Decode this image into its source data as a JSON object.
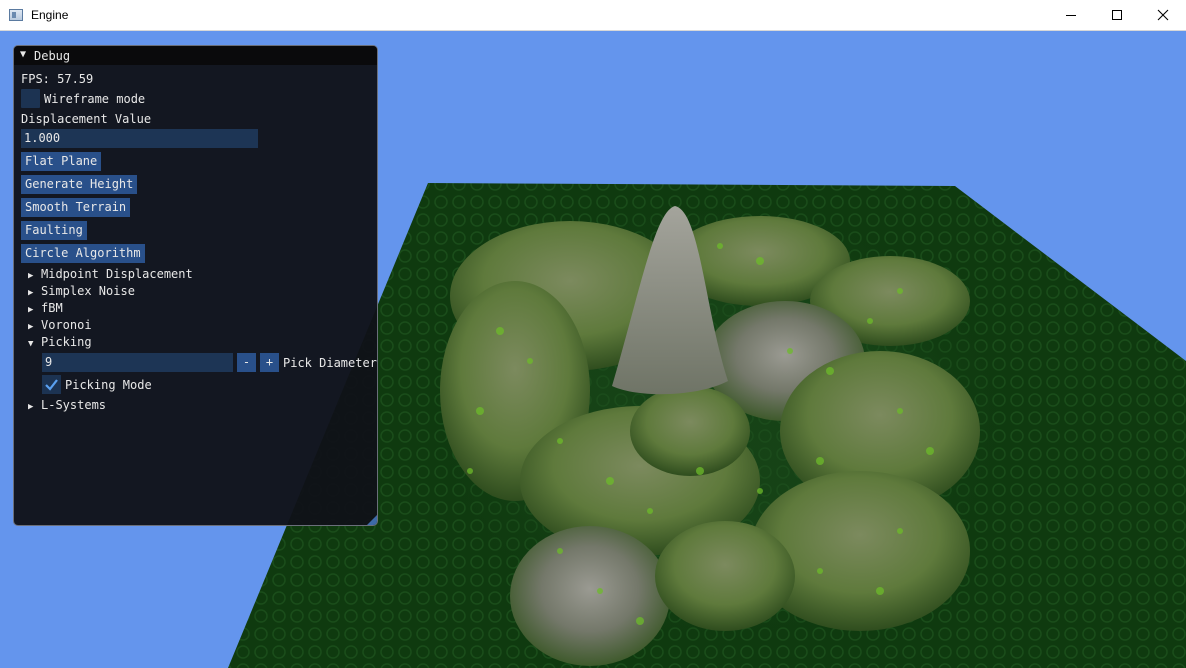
{
  "window": {
    "title": "Engine",
    "icon": "app-window-icon",
    "controls": [
      "minimize-icon",
      "maximize-icon",
      "close-icon"
    ]
  },
  "colors": {
    "sky": "#6495ed",
    "terrain_grass": "#0f3a0f",
    "panel_bg": "#101218",
    "widget_bg": "#1d3555",
    "button_bg": "#29508a",
    "check_mark": "#5aa0f0"
  },
  "debug": {
    "title": "Debug",
    "fps_label": "FPS: 57.59",
    "wireframe_label": "Wireframe mode",
    "wireframe_checked": false,
    "displacement_label": "Displacement Value",
    "displacement_value": "1.000",
    "buttons": {
      "flat_plane": "Flat Plane",
      "generate_height": "Generate Height",
      "smooth_terrain": "Smooth Terrain",
      "faulting": "Faulting",
      "circle_algorithm": "Circle Algorithm"
    },
    "sections": {
      "midpoint": "Midpoint Displacement",
      "simplex": "Simplex Noise",
      "fbm": "fBM",
      "voronoi": "Voronoi",
      "picking": "Picking",
      "lsystems": "L-Systems"
    },
    "picking": {
      "diameter_value": "9",
      "minus": "-",
      "plus": "+",
      "diameter_label": "Pick Diameter",
      "mode_label": "Picking Mode",
      "mode_checked": true
    }
  }
}
